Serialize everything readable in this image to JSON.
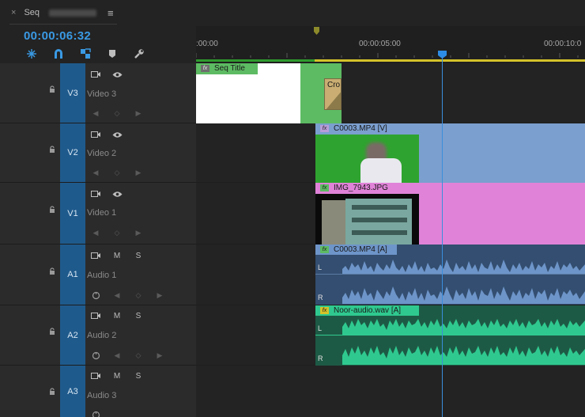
{
  "sequence_tab": {
    "close_glyph": "×",
    "label": "Seq",
    "menu_glyph": "≡"
  },
  "timecode": "00:00:06:32",
  "toolbar": {
    "tools": [
      {
        "name": "nest-sequence-icon"
      },
      {
        "name": "snap-magnet-icon"
      },
      {
        "name": "linked-selection-icon"
      },
      {
        "name": "add-marker-icon"
      },
      {
        "name": "timeline-settings-wrench-icon"
      }
    ]
  },
  "ruler": {
    "labels": [
      ":00:00",
      "00:00:05:00",
      "00:00:10:0"
    ]
  },
  "tracks": [
    {
      "id": "V3",
      "name": "Video 3",
      "type": "video"
    },
    {
      "id": "V2",
      "name": "Video 2",
      "type": "video"
    },
    {
      "id": "V1",
      "name": "Video 1",
      "type": "video"
    },
    {
      "id": "A1",
      "name": "Audio 1",
      "type": "audio",
      "mute": "M",
      "solo": "S"
    },
    {
      "id": "A2",
      "name": "Audio 2",
      "type": "audio",
      "mute": "M",
      "solo": "S"
    },
    {
      "id": "A3",
      "name": "Audio 3",
      "type": "audio",
      "mute": "M",
      "solo": "S"
    }
  ],
  "clips": {
    "seq_title": {
      "label": "Seq Title"
    },
    "cross": {
      "label": "Cro"
    },
    "c0003_video": {
      "label": "C0003.MP4 [V]"
    },
    "img_7943": {
      "label": "IMG_7943.JPG"
    },
    "c0003_audio": {
      "label": "C0003.MP4 [A]",
      "left": "L",
      "right": "R"
    },
    "noor_audio": {
      "label": "Noor-audio.wav [A]",
      "left": "L",
      "right": "R"
    }
  },
  "colors": {
    "accent": "#3a9ae4",
    "track_target": "#1f5a8c",
    "video_clip_blue": "#7b9fcf",
    "image_clip_pink": "#e083d8",
    "title_clip_green": "#5dbb63",
    "audio_blue": "#6e95c9",
    "audio_green": "#2fc98f"
  }
}
